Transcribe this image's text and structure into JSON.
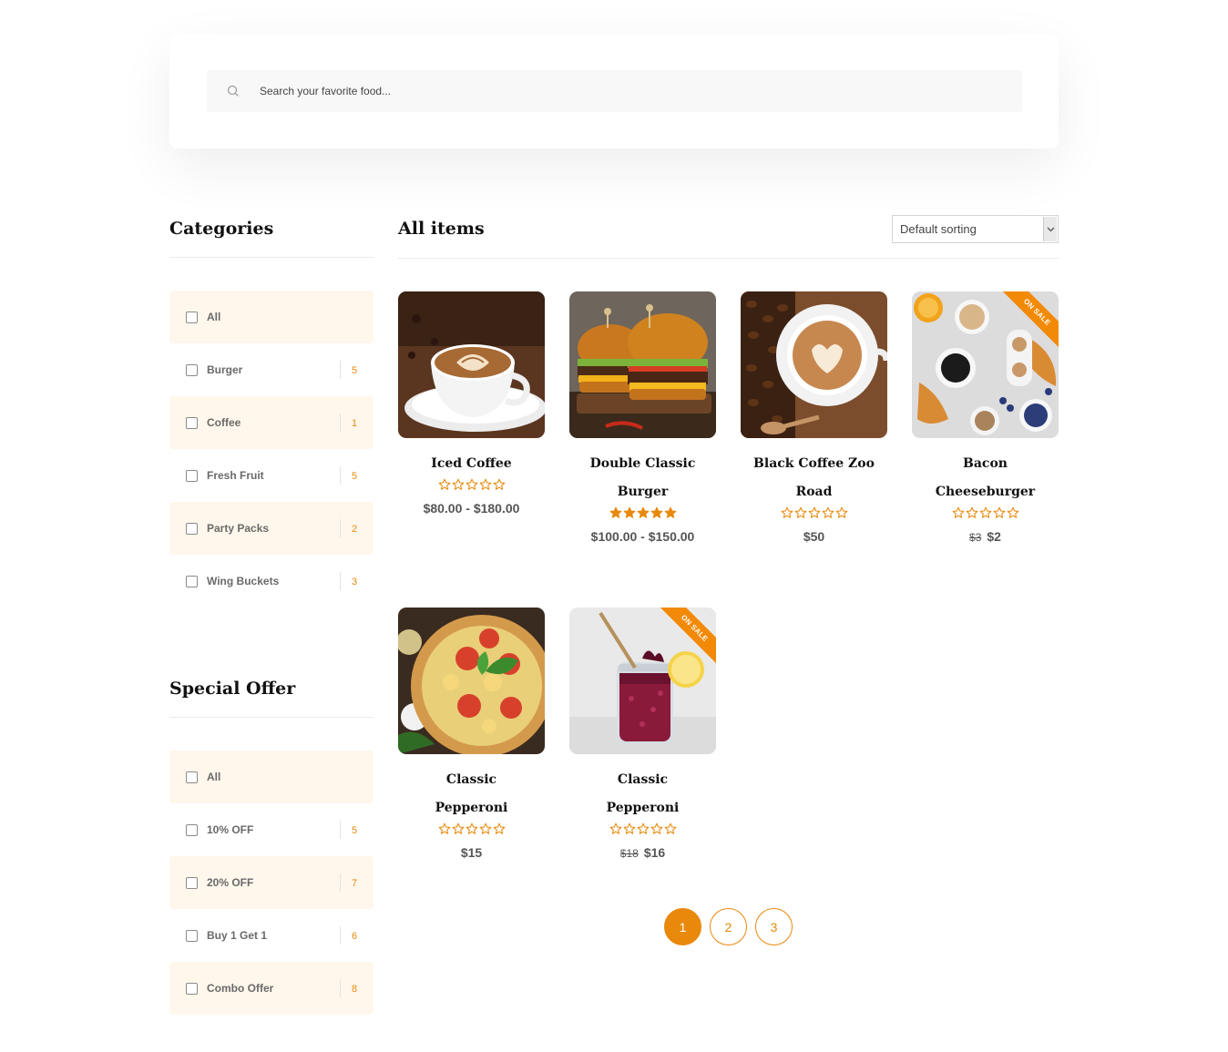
{
  "search": {
    "placeholder": "Search your favorite food..."
  },
  "categories": {
    "title": "Categories",
    "items": [
      {
        "label": "All",
        "count": ""
      },
      {
        "label": "Burger",
        "count": "5"
      },
      {
        "label": "Coffee",
        "count": "1"
      },
      {
        "label": "Fresh Fruit",
        "count": "5"
      },
      {
        "label": "Party Packs",
        "count": "2"
      },
      {
        "label": "Wing Buckets",
        "count": "3"
      }
    ]
  },
  "special_offer": {
    "title": "Special Offer",
    "items": [
      {
        "label": "All",
        "count": ""
      },
      {
        "label": "10% OFF",
        "count": "5"
      },
      {
        "label": "20% OFF",
        "count": "7"
      },
      {
        "label": "Buy 1 Get 1",
        "count": "6"
      },
      {
        "label": "Combo Offer",
        "count": "8"
      }
    ]
  },
  "main": {
    "title": "All items",
    "sort_label": "Default sorting"
  },
  "products": [
    {
      "name": "Iced Coffee",
      "rating": 0,
      "price": "$80.00 - $180.00",
      "old_price": "",
      "on_sale": false,
      "image": "coffee-latte-art"
    },
    {
      "name": "Double Classic Burger",
      "rating": 5,
      "price": "$100.00 - $150.00",
      "old_price": "",
      "on_sale": false,
      "image": "burgers"
    },
    {
      "name": "Black Coffee Zoo Road",
      "rating": 0,
      "price": "$50",
      "old_price": "",
      "on_sale": false,
      "image": "coffee-beans-cup"
    },
    {
      "name": "Bacon Cheeseburger",
      "rating": 0,
      "price": "$2",
      "old_price": "$3",
      "on_sale": true,
      "image": "breakfast-croissants"
    },
    {
      "name": "Classic Pepperoni",
      "rating": 0,
      "price": "$15",
      "old_price": "",
      "on_sale": false,
      "image": "pizza"
    },
    {
      "name": "Classic Pepperoni",
      "rating": 0,
      "price": "$16",
      "old_price": "$18",
      "on_sale": true,
      "image": "berry-drink-jar"
    }
  ],
  "sale_badge": "ON SALE",
  "pagination": {
    "pages": [
      "1",
      "2",
      "3"
    ],
    "current": "1"
  },
  "colors": {
    "accent": "#e8890c",
    "shade": "#fff7ec",
    "ribbon": "#f28a07"
  }
}
